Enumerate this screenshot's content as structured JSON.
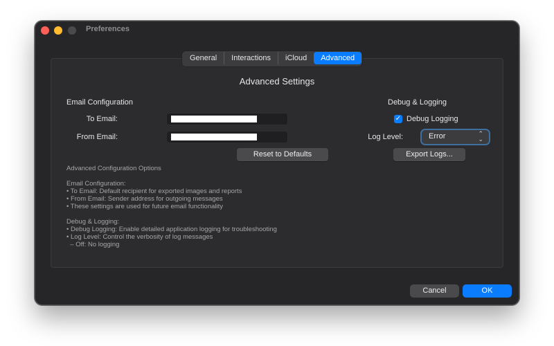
{
  "window": {
    "title": "Preferences"
  },
  "tabs": [
    {
      "label": "General"
    },
    {
      "label": "Interactions"
    },
    {
      "label": "iCloud"
    },
    {
      "label": "Advanced",
      "active": true
    }
  ],
  "advanced": {
    "title": "Advanced Settings",
    "email_section": "Email Configuration",
    "to_email_label": "To Email:",
    "to_email_value": "",
    "from_email_label": "From Email:",
    "from_email_value": "",
    "reset_button": "Reset to Defaults",
    "debug_section": "Debug & Logging",
    "debug_logging_label": "Debug Logging",
    "debug_logging_checked": true,
    "log_level_label": "Log Level:",
    "log_level_value": "Error",
    "export_button": "Export Logs..."
  },
  "notes": {
    "heading": "Advanced Configuration Options",
    "email_heading": "Email Configuration:",
    "email_lines": [
      "• To Email: Default recipient for exported images and reports",
      "• From Email: Sender address for outgoing messages",
      "• These settings are used for future email functionality"
    ],
    "debug_heading": "Debug & Logging:",
    "debug_lines": [
      "• Debug Logging: Enable detailed application logging for troubleshooting",
      "• Log Level: Control the verbosity of log messages",
      "  – Off: No logging"
    ]
  },
  "footer": {
    "cancel": "Cancel",
    "ok": "OK"
  },
  "colors": {
    "accent": "#0a7cff",
    "window_bg": "#262628"
  }
}
